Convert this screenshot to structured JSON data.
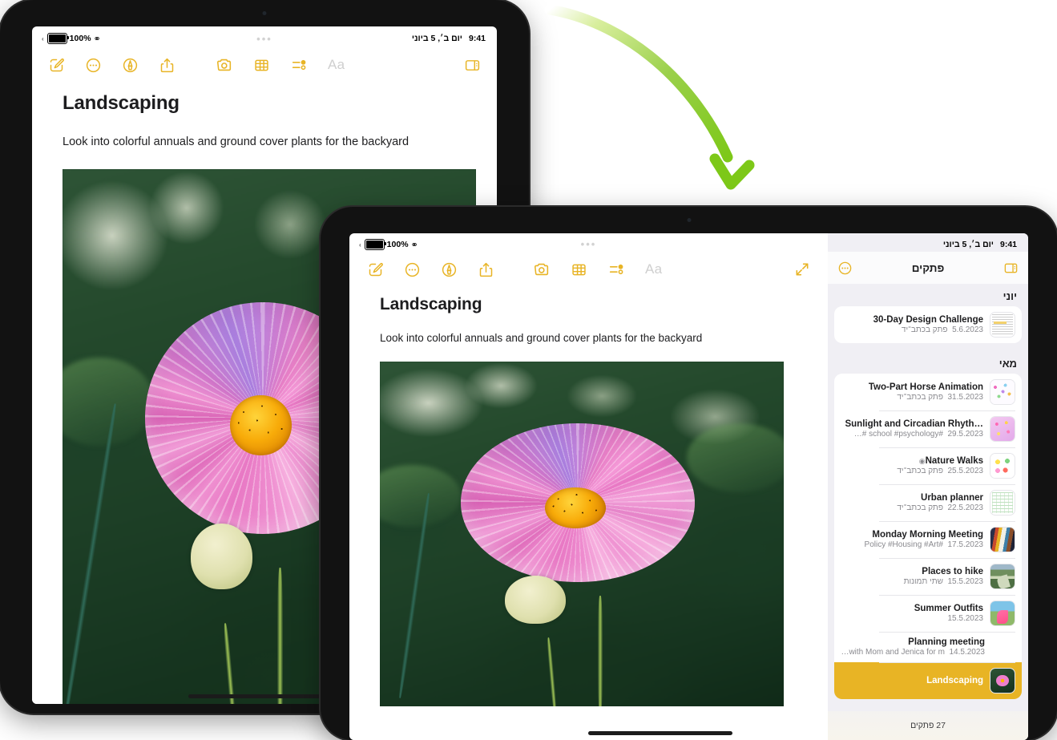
{
  "status_bar": {
    "battery_percent": "100%",
    "wifi_icon": "wifi-icon",
    "time": "9:41",
    "date": "יום ב׳, 5 ביוני"
  },
  "toolbar": {
    "compose_label": "compose-icon",
    "more_label": "more-icon",
    "markup_label": "markup-icon",
    "share_label": "share-icon",
    "camera_label": "camera-icon",
    "table_label": "table-icon",
    "checklist_label": "checklist-icon",
    "format_label": "Aa",
    "sidebar_toggle_label": "sidebar-toggle-icon",
    "expand_label": "expand-icon"
  },
  "note": {
    "title": "Landscaping",
    "body": "Look into colorful annuals and ground cover plants for the backyard",
    "photo_alt": "pink cosmos flower in a garden"
  },
  "notes_list": {
    "header_title": "פתקים",
    "more_icon": "more-icon",
    "sidebar_icon": "sidebar-toggle-icon",
    "footer_count": "27 פתקים",
    "sections": [
      {
        "label": "יוני",
        "items": [
          {
            "title": "30-Day Design Challenge",
            "preview": "פתק בכתב־יד",
            "date": "5.6.2023",
            "thumb": "doc-thumbnail",
            "shared": false,
            "selected": false
          }
        ]
      },
      {
        "label": "מאי",
        "items": [
          {
            "title": "Two-Part Horse Animation",
            "preview": "פתק בכתב־יד",
            "date": "31.5.2023",
            "thumb": "confetti-thumbnail",
            "shared": false,
            "selected": false
          },
          {
            "title": "Sunlight and Circadian Rhyth…",
            "preview": "#school #psychology #…",
            "date": "29.5.2023",
            "thumb": "pink-sparkle-thumbnail",
            "shared": false,
            "selected": false
          },
          {
            "title": "Nature Walks",
            "preview": "פתק בכתב־יד",
            "date": "25.5.2023",
            "thumb": "nature-thumbnail",
            "shared": true,
            "selected": false
          },
          {
            "title": "Urban planner",
            "preview": "פתק בכתב־יד",
            "date": "22.5.2023",
            "thumb": "plan-thumbnail",
            "shared": false,
            "selected": false
          },
          {
            "title": "Monday Morning Meeting",
            "preview": "#Policy #Housing #Art",
            "date": "17.5.2023",
            "thumb": "art-thumbnail",
            "shared": false,
            "selected": false
          },
          {
            "title": "Places to hike",
            "preview": "שתי תמונות",
            "date": "15.5.2023",
            "thumb": "hike-thumbnail",
            "shared": false,
            "selected": false
          },
          {
            "title": "Summer Outfits",
            "preview": "",
            "date": "15.5.2023",
            "thumb": "summer-thumbnail",
            "shared": false,
            "selected": false
          },
          {
            "title": "Planning meeting",
            "preview": "Meet with Mom and Jenica for m…",
            "date": "14.5.2023",
            "thumb": "",
            "shared": false,
            "selected": false
          },
          {
            "title": "Landscaping",
            "preview": "",
            "date": "",
            "thumb": "flower-thumbnail",
            "shared": false,
            "selected": true
          }
        ]
      }
    ]
  },
  "annotation": {
    "arrow_name": "green-curved-arrow",
    "arrow_color": "#8cc63f"
  }
}
